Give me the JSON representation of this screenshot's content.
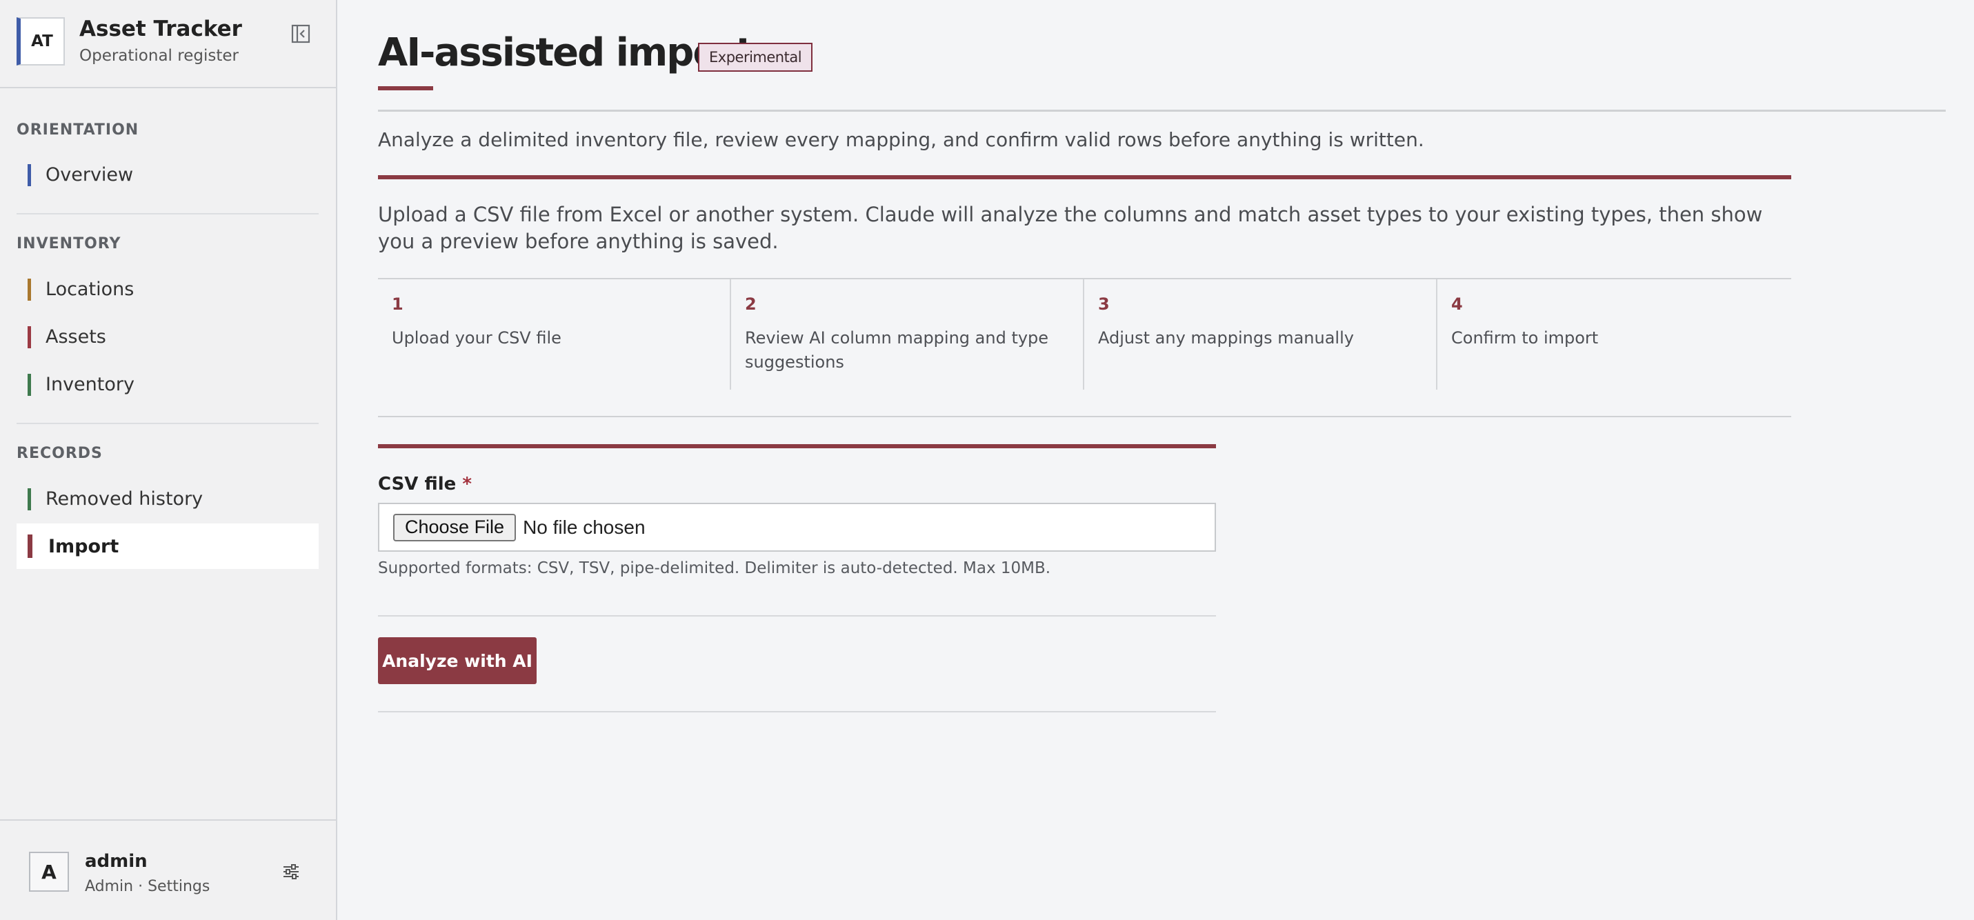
{
  "brand": {
    "logo_text": "AT",
    "name": "Asset Tracker",
    "subtitle": "Operational register"
  },
  "sidebar": {
    "groups": [
      {
        "label": "ORIENTATION",
        "items": [
          {
            "label": "Overview",
            "accent": "#3f5ca8"
          }
        ]
      },
      {
        "label": "INVENTORY",
        "items": [
          {
            "label": "Locations",
            "accent": "#a9782f"
          },
          {
            "label": "Assets",
            "accent": "#9b3a44"
          },
          {
            "label": "Inventory",
            "accent": "#3f7a4e"
          }
        ]
      },
      {
        "label": "RECORDS",
        "items": [
          {
            "label": "Removed history",
            "accent": "#3f7a4e"
          },
          {
            "label": "Import",
            "accent": "#8b3a43",
            "active": true
          }
        ]
      }
    ]
  },
  "user": {
    "avatar": "A",
    "name": "admin",
    "meta": "Admin · Settings"
  },
  "page": {
    "title": "AI-assisted import",
    "badge": "Experimental",
    "lede": "Analyze a delimited inventory file, review every mapping, and confirm valid rows before anything is written.",
    "intro": "Upload a CSV file from Excel or another system. Claude will analyze the columns and match asset types to your existing types, then show you a preview before anything is saved.",
    "steps": [
      {
        "num": "1",
        "text": "Upload your CSV file"
      },
      {
        "num": "2",
        "text": "Review AI column mapping and type suggestions"
      },
      {
        "num": "3",
        "text": "Adjust any mappings manually"
      },
      {
        "num": "4",
        "text": "Confirm to import"
      }
    ]
  },
  "form": {
    "label": "CSV file",
    "required_mark": "*",
    "choose_button": "Choose File",
    "file_status": "No file chosen",
    "hint": "Supported formats: CSV, TSV, pipe-delimited. Delimiter is auto-detected. Max 10MB.",
    "submit": "Analyze with AI"
  },
  "colors": {
    "accent": "#8b3a43",
    "background": "#f4f5f7",
    "sidebar": "#f1f1f2"
  }
}
